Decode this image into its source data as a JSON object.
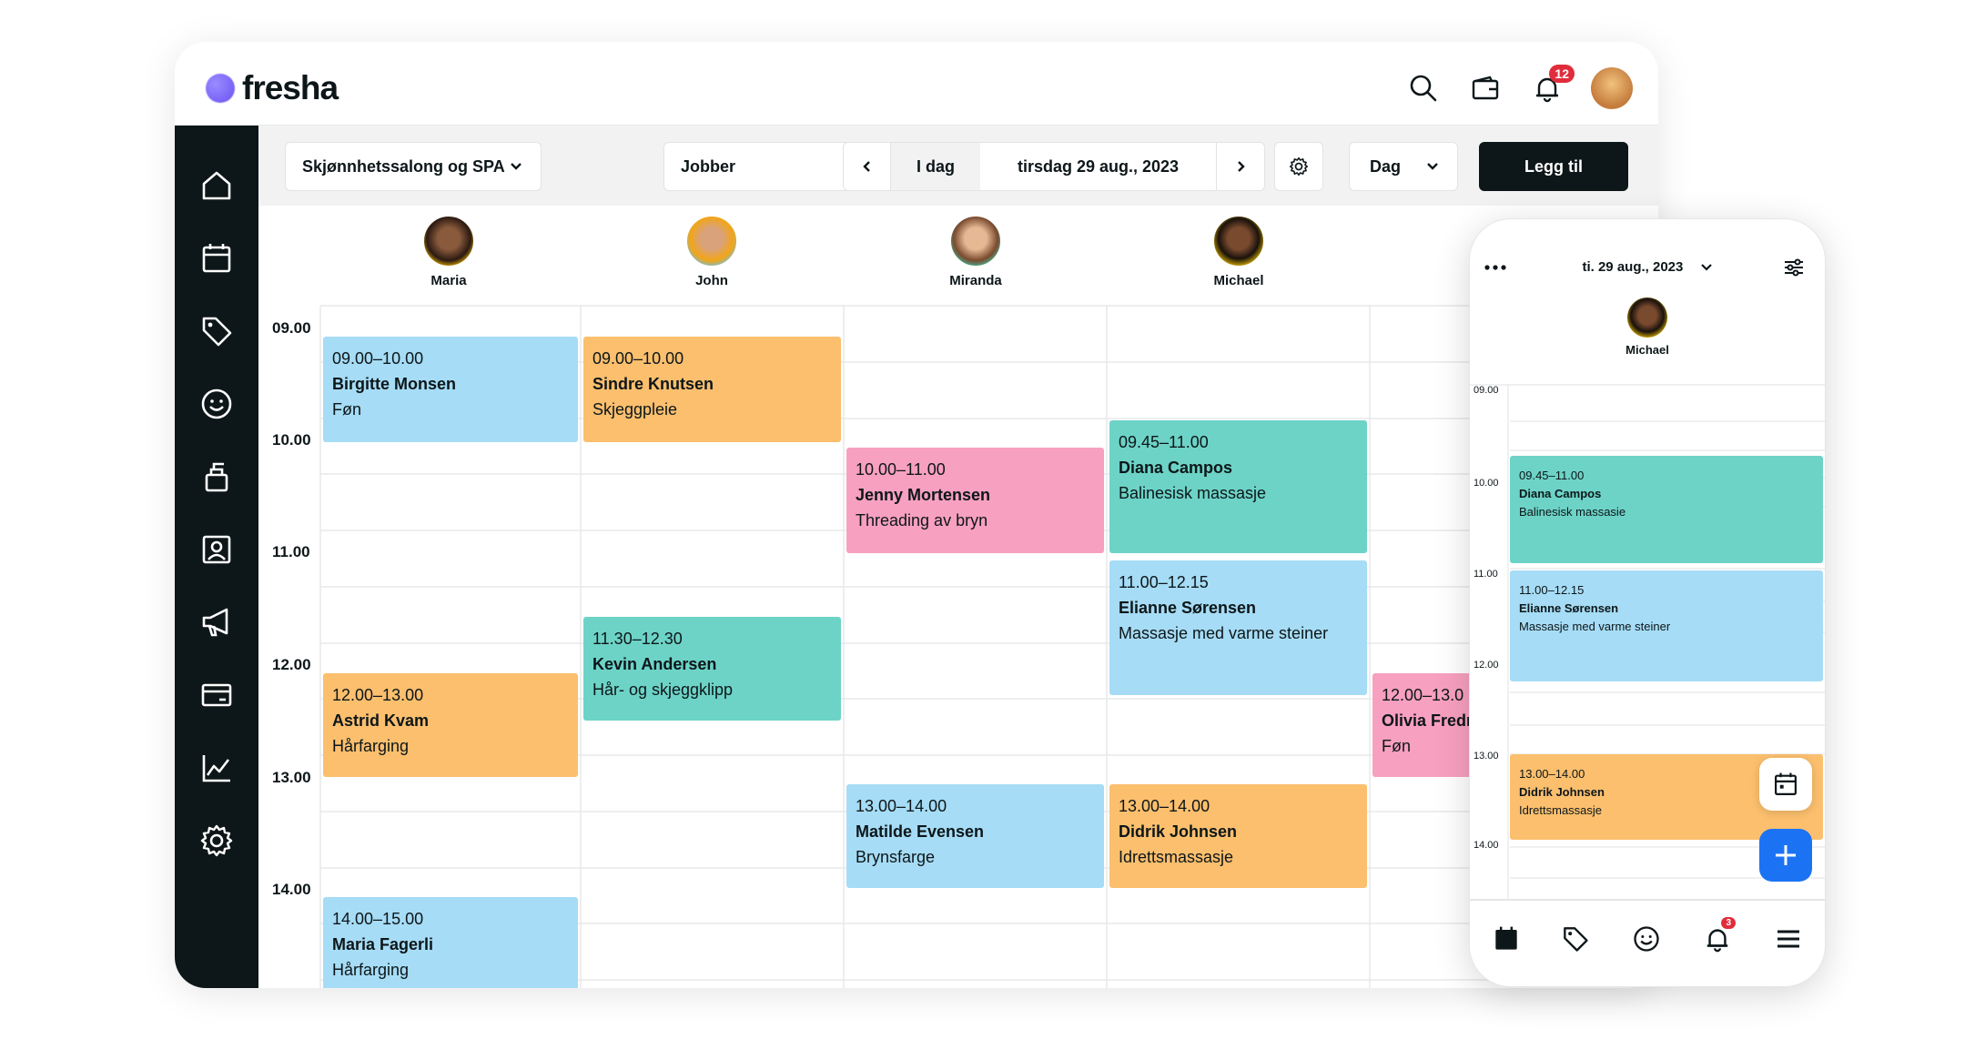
{
  "app": {
    "brand": "fresha",
    "notifications": "12"
  },
  "sidebar": {
    "items": [
      {
        "icon": "home-icon"
      },
      {
        "icon": "calendar-icon"
      },
      {
        "icon": "tag-icon"
      },
      {
        "icon": "smiley-icon"
      },
      {
        "icon": "product-bottle-icon"
      },
      {
        "icon": "contact-card-icon"
      },
      {
        "icon": "megaphone-icon"
      },
      {
        "icon": "card-icon"
      },
      {
        "icon": "chart-icon"
      },
      {
        "icon": "gear-icon"
      }
    ]
  },
  "toolbar": {
    "location": "Skjønnhetssalong og SPA",
    "staff_filter": "Jobber",
    "today": "I dag",
    "date": "tirsdag 29 aug., 2023",
    "view": "Dag",
    "add": "Legg til"
  },
  "staff": [
    "Maria",
    "John",
    "Miranda",
    "Michael"
  ],
  "times": [
    "09.00",
    "10.00",
    "11.00",
    "12.00",
    "13.00",
    "14.00"
  ],
  "appointments": [
    {
      "time": "09.00–10.00",
      "name": "Birgitte Monsen",
      "service": "Føn"
    },
    {
      "time": "12.00–13.00",
      "name": "Astrid Kvam",
      "service": "Hårfarging"
    },
    {
      "time": "14.00–15.00",
      "name": "Maria Fagerli",
      "service": "Hårfarging"
    },
    {
      "time": "09.00–10.00",
      "name": "Sindre Knutsen",
      "service": "Skjeggpleie"
    },
    {
      "time": "11.30–12.30",
      "name": "Kevin Andersen",
      "service": "Hår- og skjeggklipp"
    },
    {
      "time": "10.00–11.00",
      "name": "Jenny Mortensen",
      "service": "Threading av bryn"
    },
    {
      "time": "13.00–14.00",
      "name": "Matilde Evensen",
      "service": "Brynsfarge"
    },
    {
      "time": "09.45–11.00",
      "name": "Diana Campos",
      "service": "Balinesisk massasje"
    },
    {
      "time": "11.00–12.15",
      "name": "Elianne Sørensen",
      "service": "Massasje med varme steiner"
    },
    {
      "time": "13.00–14.00",
      "name": "Didrik Johnsen",
      "service": "Idrettsmassasje"
    },
    {
      "time": "12.00–13.0",
      "name": "Olivia Fredr",
      "service": "Føn"
    }
  ],
  "phone": {
    "date": "ti. 29 aug., 2023",
    "staff": "Michael",
    "times": [
      "09.00",
      "10.00",
      "11.00",
      "12.00",
      "13.00",
      "14.00"
    ],
    "appointments": [
      {
        "time": "09.45–11.00",
        "name": "Diana Campos",
        "service": "Balinesisk massasie"
      },
      {
        "time": "11.00–12.15",
        "name": "Elianne Sørensen",
        "service": "Massasje med varme steiner"
      },
      {
        "time": "13.00–14.00",
        "name": "Didrik Johnsen",
        "service": "Idrettsmassasje"
      }
    ],
    "nav_badge": "3"
  },
  "colors": {
    "dark": "#0d1619",
    "blue": "#a6dcf5",
    "orange": "#fbbf6e",
    "pink": "#f8a0bf",
    "teal": "#6dd3c7",
    "accent": "#1b73f4"
  }
}
